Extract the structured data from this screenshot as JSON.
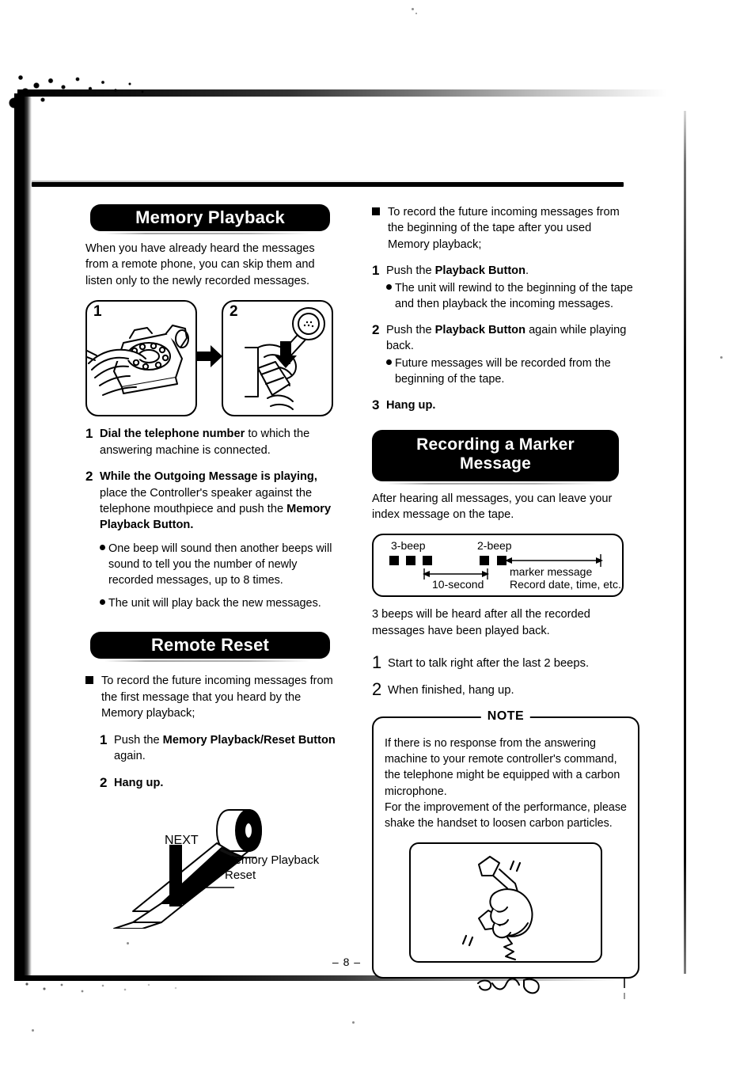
{
  "page": {
    "number_label": "– 8 –"
  },
  "left_column": {
    "heading_memory_playback": "Memory Playback",
    "intro": "When you have already heard the messages from a remote phone, you can skip them and listen only to the newly recorded messages.",
    "illustration": {
      "panel1_label": "1",
      "panel1_name": "rotary-telephone-dialing",
      "panel2_label": "2",
      "panel2_name": "handset-with-remote-controller",
      "arrow_name": "right-arrow"
    },
    "steps": [
      {
        "num": "1",
        "bold": "Dial the telephone number",
        "rest": " to which the answering machine is connected."
      },
      {
        "num": "2",
        "bold": "While the Outgoing Message is playing,",
        "rest": " place the Controller's speaker against the telephone mouthpiece and push the ",
        "bold2": "Memory Playback Button."
      }
    ],
    "bullets": [
      "One beep will sound then another beeps will sound to tell you the number of newly recorded messages, up to 8 times.",
      "The unit will play back the new messages."
    ],
    "heading_remote_reset": "Remote Reset",
    "remote_reset_intro": "To record the future incoming messages from the first message that you heard by the Memory playback;",
    "remote_reset_steps": [
      {
        "num": "1",
        "pre": "Push the ",
        "bold": "Memory Playback/Reset Button",
        "rest": " again."
      },
      {
        "num": "2",
        "bold": "Hang up.",
        "pre": "",
        "rest": ""
      }
    ],
    "tape_diagram": {
      "name": "cassette-tape-diagram",
      "label_next": "NEXT",
      "label_marker_line1": "Memory Playback",
      "label_marker_line2": "Reset"
    }
  },
  "right_column": {
    "intro_bullet": "To record the future incoming messages from the beginning of the tape after you used Memory playback;",
    "steps": [
      {
        "num": "1",
        "pre": "Push the ",
        "bold": "Playback Button",
        "rest": ".",
        "sub": "The unit will rewind to the beginning of the tape and then playback the incoming messages."
      },
      {
        "num": "2",
        "pre": "Push the ",
        "bold": "Playback Button",
        "rest": " again while playing back.",
        "sub": "Future messages will be recorded from the beginning of the tape."
      },
      {
        "num": "3",
        "pre": "",
        "bold": "Hang up.",
        "rest": "",
        "sub": ""
      }
    ],
    "heading_marker_line1": "Recording a Marker",
    "heading_marker_line2": "Message",
    "marker_intro": "After hearing all messages, you can leave your index message on the tape.",
    "beep_diagram": {
      "name": "beep-timing-diagram",
      "label_3beep": "3-beep",
      "label_2beep": "2-beep",
      "label_10second": "10-second",
      "label_marker_message": "marker message",
      "label_record_date": "Record date, time, etc.",
      "beeps_group1": 3,
      "beeps_group2": 2
    },
    "after_beep_text": "3 beeps will be heard after all the recorded messages have been played back.",
    "talk_steps": [
      {
        "num": "1",
        "text": "Start to talk right after the last 2 beeps."
      },
      {
        "num": "2",
        "text": "When finished, hang up."
      }
    ],
    "note": {
      "title": "NOTE",
      "body_line1": "If there is no response from the answering machine to your remote controller's command, the telephone might be equipped with a carbon microphone.",
      "body_line2": "For the improvement of the performance, please shake the handset to loosen carbon particles.",
      "illustration_name": "hand-shaking-handset"
    }
  },
  "colors": {
    "ink": "#000000",
    "paper": "#ffffff",
    "heading_text": "#ffffff"
  }
}
